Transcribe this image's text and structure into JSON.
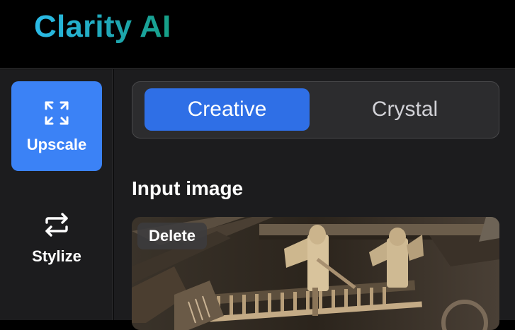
{
  "app": {
    "title": "Clarity AI"
  },
  "sidebar": {
    "items": [
      {
        "label": "Upscale",
        "icon": "expand-arrows-icon",
        "active": true
      },
      {
        "label": "Stylize",
        "icon": "repeat-arrows-icon",
        "active": false
      }
    ]
  },
  "main": {
    "modes": [
      {
        "label": "Creative",
        "active": true
      },
      {
        "label": "Crystal",
        "active": false
      }
    ],
    "input_section_title": "Input image",
    "delete_label": "Delete"
  },
  "colors": {
    "accent": "#3b82f6",
    "mode_active": "#2f6fe6",
    "panel": "#1c1c1e",
    "logo_gradient_start": "#2bbbe8",
    "logo_gradient_end": "#16a085"
  }
}
